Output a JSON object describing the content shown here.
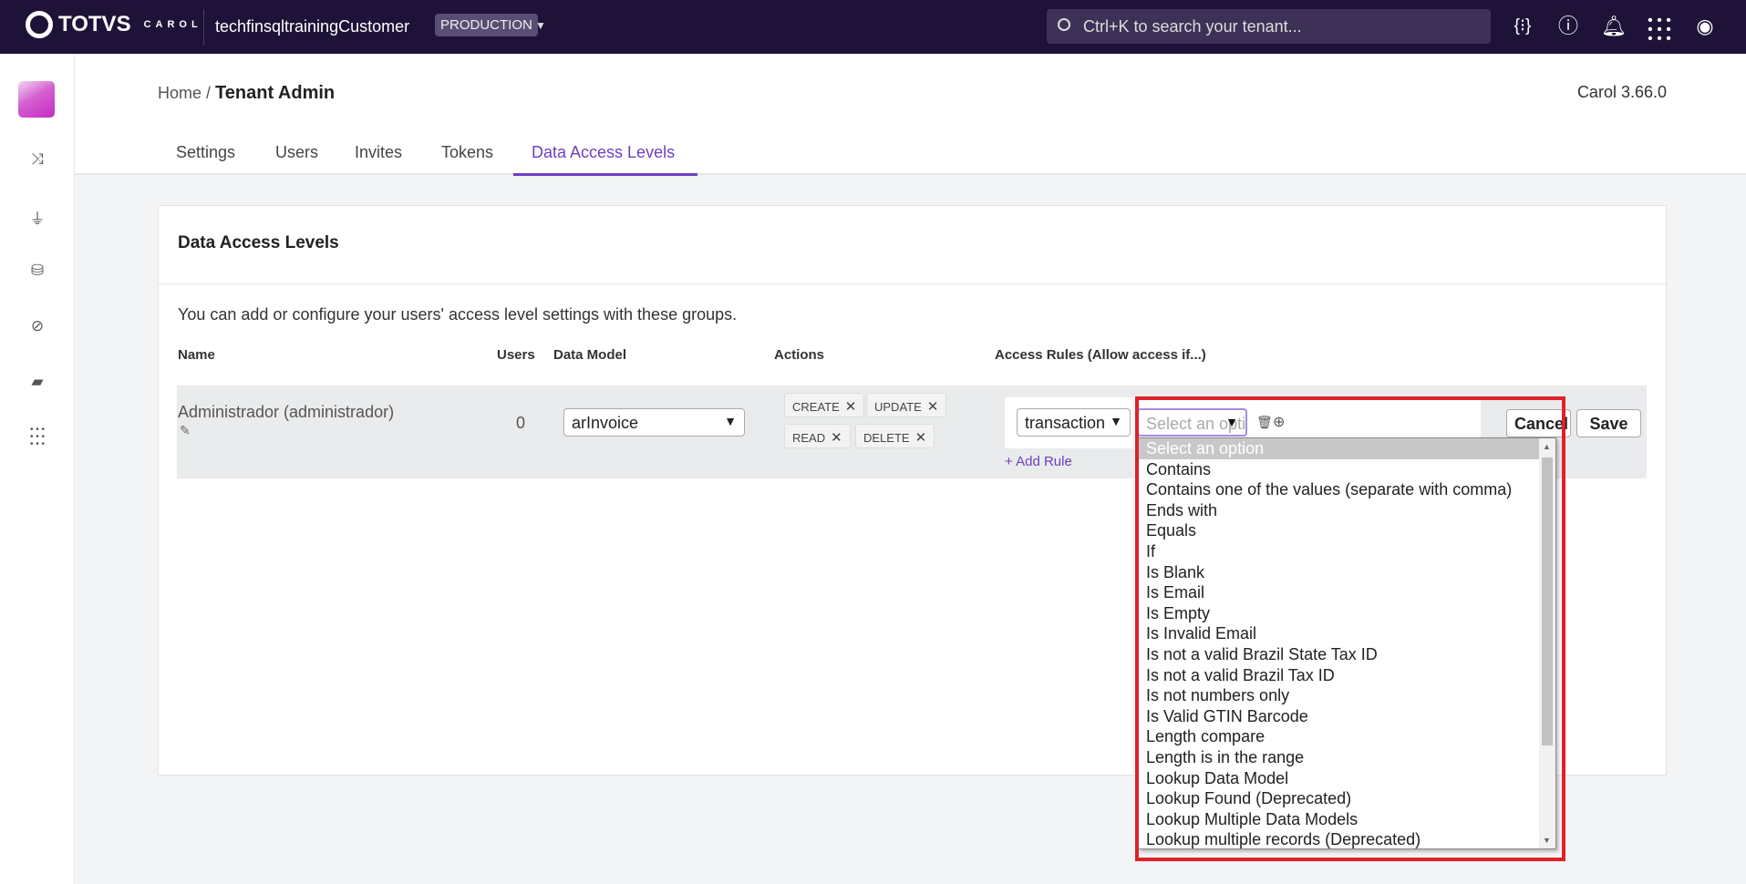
{
  "topbar": {
    "brand": "TOTVS",
    "brand_sub": "CAROL",
    "tenant": "techfinsqltrainingCustomer",
    "environment": "PRODUCTION",
    "search_placeholder": "Ctrl+K to search your tenant...",
    "icons": [
      "code-braces-icon",
      "help-icon",
      "bell-icon",
      "apps-grid-icon",
      "user-account-icon"
    ]
  },
  "sidebar": {
    "icons": [
      "app-logo",
      "flow-icon",
      "plug-icon",
      "database-icon",
      "compass-icon",
      "chat-icon",
      "apps-grid-icon"
    ]
  },
  "breadcrumb": {
    "home": "Home",
    "separator": " / ",
    "current": "Tenant Admin"
  },
  "version": "Carol 3.66.0",
  "tabs": [
    {
      "label": "Settings"
    },
    {
      "label": "Users"
    },
    {
      "label": "Invites"
    },
    {
      "label": "Tokens"
    },
    {
      "label": "Data Access Levels",
      "active": true
    }
  ],
  "card": {
    "title": "Data Access Levels",
    "description": "You can add or configure your users' access level settings with these groups.",
    "columns": [
      "Name",
      "Users",
      "Data Model",
      "Actions",
      "Access Rules (Allow access if...)"
    ],
    "row": {
      "name": "Administrador (administrador)",
      "users": "0",
      "data_model": "arInvoice",
      "actions": [
        "CREATE",
        "UPDATE",
        "READ",
        "DELETE"
      ],
      "rule_field": "transaction",
      "rule_operator_placeholder": "Select an option",
      "add_rule": "+ Add Rule",
      "cancel": "Cancel",
      "save": "Save"
    }
  },
  "dropdown": {
    "options": [
      "Select an option",
      "Contains",
      "Contains one of the values (separate with comma)",
      "Ends with",
      "Equals",
      "If",
      "Is Blank",
      "Is Email",
      "Is Empty",
      "Is Invalid Email",
      "Is not a valid Brazil State Tax ID",
      "Is not a valid Brazil Tax ID",
      "Is not numbers only",
      "Is Valid GTIN Barcode",
      "Length compare",
      "Length is in the range",
      "Lookup Data Model",
      "Lookup Found (Deprecated)",
      "Lookup Multiple Data Models",
      "Lookup multiple records (Deprecated)"
    ],
    "selected": "Select an option"
  },
  "colors": {
    "topbar": "#1f1238",
    "accent": "#6d3fc0",
    "highlight_box": "#e0202a"
  }
}
